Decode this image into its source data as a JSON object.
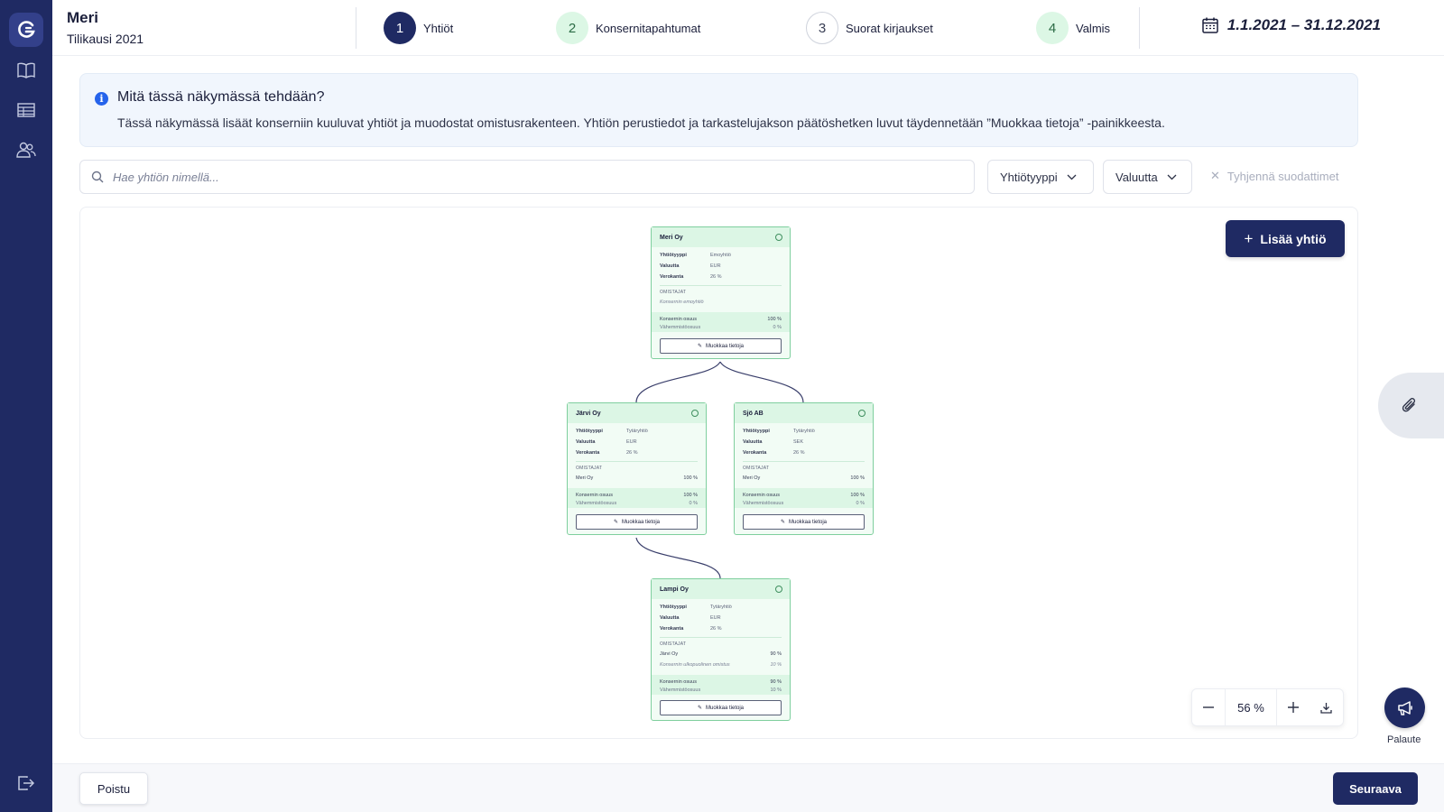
{
  "header": {
    "org_name": "Meri",
    "fiscal_year": "Tilikausi 2021",
    "period": "1.1.2021 – 31.12.2021",
    "steps": [
      {
        "number": "1",
        "label": "Yhtiöt",
        "state": "active"
      },
      {
        "number": "2",
        "label": "Konsernitapahtumat",
        "state": "done"
      },
      {
        "number": "3",
        "label": "Suorat kirjaukset",
        "state": "todo"
      },
      {
        "number": "4",
        "label": "Valmis",
        "state": "done"
      }
    ]
  },
  "sidebar": {
    "items": [
      {
        "icon": "logo-icon"
      },
      {
        "icon": "book-icon"
      },
      {
        "icon": "table-icon"
      },
      {
        "icon": "users-icon"
      },
      {
        "icon": "logout-icon"
      }
    ]
  },
  "info": {
    "title": "Mitä tässä näkymässä tehdään?",
    "text": "Tässä näkymässä lisäät konserniin kuuluvat yhtiöt ja muodostat omistusrakenteen. Yhtiön perustiedot ja tarkastelujakson päätöshetken luvut täydennetään ”Muokkaa tietoja” -painikkeesta."
  },
  "filters": {
    "search_placeholder": "Hae yhtiön nimellä...",
    "search_value": "",
    "company_type": "Yhtiötyyppi",
    "currency": "Valuutta",
    "clear": "Tyhjennä suodattimet"
  },
  "canvas": {
    "add_company": "Lisää yhtiö",
    "zoom": "56 %"
  },
  "labels": {
    "type": "Yhtiötyyppi",
    "currency": "Valuutta",
    "tax_rate": "Verokanta",
    "owners": "OMISTAJAT",
    "group_share": "Konsernin osuus",
    "minority_share": "Vähemmistöosuus",
    "edit": "Muokkaa tietoja"
  },
  "companies": [
    {
      "name": "Meri Oy",
      "type": "Emoyhtiö",
      "currency": "EUR",
      "tax_rate": "26 %",
      "owners": [
        {
          "name": "Konsernin emoyhtiö",
          "pct": "",
          "italic": true
        }
      ],
      "group_share": "100 %",
      "minority_share": "0 %"
    },
    {
      "name": "Järvi Oy",
      "type": "Tytäryhtiö",
      "currency": "EUR",
      "tax_rate": "26 %",
      "owners": [
        {
          "name": "Meri Oy",
          "pct": "100 %",
          "italic": false
        }
      ],
      "group_share": "100 %",
      "minority_share": "0 %"
    },
    {
      "name": "Sjö AB",
      "type": "Tytäryhtiö",
      "currency": "SEK",
      "tax_rate": "26 %",
      "owners": [
        {
          "name": "Meri Oy",
          "pct": "100 %",
          "italic": false
        }
      ],
      "group_share": "100 %",
      "minority_share": "0 %"
    },
    {
      "name": "Lampi Oy",
      "type": "Tytäryhtiö",
      "currency": "EUR",
      "tax_rate": "26 %",
      "owners": [
        {
          "name": "Järvi Oy",
          "pct": "90 %",
          "italic": false
        },
        {
          "name": "Konsernin ulkopuolinen omistus",
          "pct": "10 %",
          "italic": true
        }
      ],
      "group_share": "90 %",
      "minority_share": "10 %"
    }
  ],
  "feedback": "Palaute",
  "footer": {
    "exit": "Poistu",
    "next": "Seuraava"
  },
  "colors": {
    "navy": "#1f2a63",
    "card_green": "#f2fcf5",
    "card_border": "#7fcf9e",
    "info_bg": "#f1f6fd",
    "info_icon": "#2563eb"
  }
}
